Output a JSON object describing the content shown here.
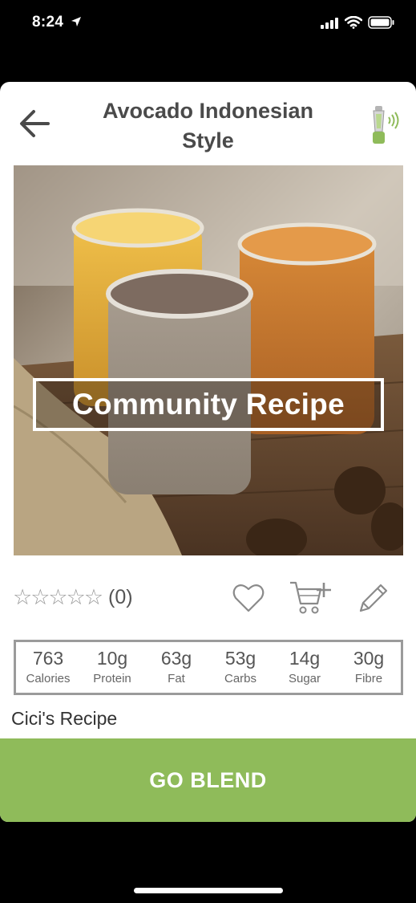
{
  "status": {
    "time": "8:24"
  },
  "header": {
    "title": "Avocado Indonesian Style"
  },
  "image": {
    "banner": "Community Recipe"
  },
  "rating": {
    "stars": "☆☆☆☆☆",
    "count": "(0)"
  },
  "nutrition": [
    {
      "value": "763",
      "label": "Calories"
    },
    {
      "value": "10g",
      "label": "Protein"
    },
    {
      "value": "63g",
      "label": "Fat"
    },
    {
      "value": "53g",
      "label": "Carbs"
    },
    {
      "value": "14g",
      "label": "Sugar"
    },
    {
      "value": "30g",
      "label": "Fibre"
    }
  ],
  "recipe_author": "Cici's Recipe",
  "primary_action": {
    "label": "GO BLEND"
  },
  "colors": {
    "accent": "#8fbb5a",
    "title": "#4a4a4a"
  }
}
